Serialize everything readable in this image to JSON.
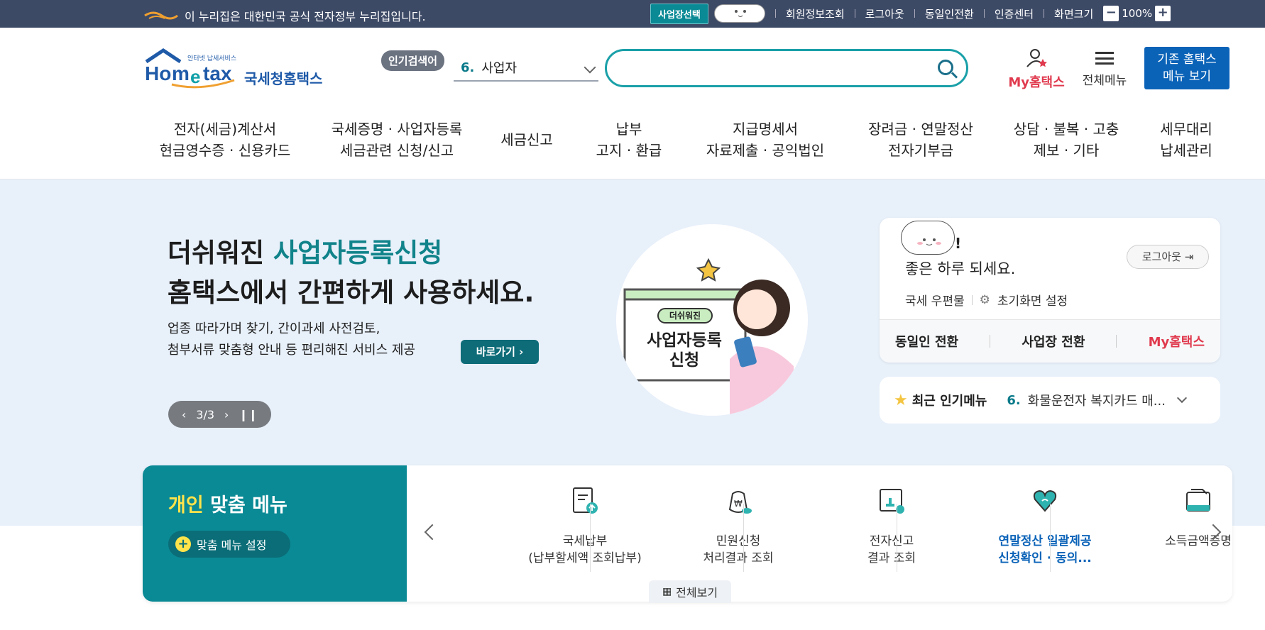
{
  "topbar": {
    "gov_notice": "이 누리집은 대한민국 공식 전자정부 누리집입니다.",
    "biz_select": "사업장선택",
    "links": [
      "회원정보조회",
      "로그아웃",
      "동일인전환",
      "인증센터",
      "화면크기"
    ],
    "zoom_minus": "−",
    "zoom_level": "100%",
    "zoom_plus": "+"
  },
  "header": {
    "brand_small": "안터넷 납세서비스",
    "brand_logo": "Hometax.",
    "brand_name": "국세청홈택스",
    "popular_tag": "인기검색어",
    "popular_rank": "6.",
    "popular_word": "사업자",
    "search_placeholder": "",
    "my_hometax": "My홈택스",
    "all_menu": "전체메뉴",
    "old_menu_line1": "기존 홈택스",
    "old_menu_line2": "메뉴 보기"
  },
  "nav": [
    {
      "l1": "전자(세금)계산서",
      "l2": "현금영수증 · 신용카드"
    },
    {
      "l1": "국세증명 · 사업자등록",
      "l2": "세금관련 신청/신고"
    },
    {
      "l1": "세금신고",
      "l2": ""
    },
    {
      "l1": "납부",
      "l2": "고지 · 환급"
    },
    {
      "l1": "지급명세서",
      "l2": "자료제출 · 공익법인"
    },
    {
      "l1": "장려금 · 연말정산",
      "l2": "전자기부금"
    },
    {
      "l1": "상담 · 불복 · 고충",
      "l2": "제보 · 기타"
    },
    {
      "l1": "세무대리",
      "l2": "납세관리"
    }
  ],
  "hero": {
    "title_a": "더쉬워진 ",
    "title_hl": "사업자등록신청",
    "title_b": "홈택스에서 간편하게 사용하세요.",
    "desc1": "업종 따라가며 찾기, 간이과세 사전검토,",
    "desc2": "첨부서류 맞춤형 안내 등 편리해진 서비스 제공",
    "go_button": "바로가기",
    "pager": "3/3",
    "illus_badge": "더쉬워진",
    "illus_line1": "사업자등록",
    "illus_line2": "신청"
  },
  "login_card": {
    "name_suffix": "!",
    "greeting": "좋은 하루 되세요.",
    "logout": "로그아웃",
    "mailbox": "국세 우편물",
    "home_setting": "초기화면 설정",
    "foot": [
      "동일인 전환",
      "사업장 전환",
      "My홈택스"
    ]
  },
  "popular_menu": {
    "label": "최근 인기메뉴",
    "rank": "6.",
    "item": "화물운전자 복지카드 매..."
  },
  "custom_menu": {
    "title_y": "개인",
    "title_w": " 맞춤 메뉴",
    "setting": "맞춤 메뉴 설정",
    "items": [
      {
        "l1": "국세납부",
        "l2": "(납부할세액 조회납부)"
      },
      {
        "l1": "민원신청",
        "l2": "처리결과 조회"
      },
      {
        "l1": "전자신고",
        "l2": "결과 조회"
      },
      {
        "l1": "연말정산 일괄제공",
        "l2": "신청확인 · 동의..."
      },
      {
        "l1": "소득금액증명",
        "l2": ""
      }
    ],
    "view_all": "전체보기"
  },
  "colors": {
    "topbar": "#3d4a66",
    "teal": "#0a8a95",
    "accent_red": "#e03a4e",
    "blue": "#0b63b8",
    "hero_bg": "#e8f0fa"
  }
}
